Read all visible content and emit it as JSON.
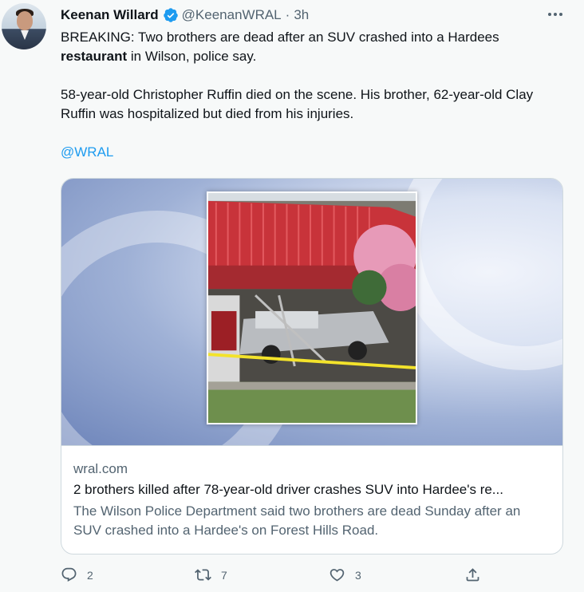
{
  "tweet": {
    "author_name": "Keenan Willard",
    "handle": "@KeenanWRAL",
    "separator": "·",
    "time": "3h",
    "text_line1_a": "BREAKING: Two brothers are dead after an SUV crashed into a Hardees",
    "text_line2_bold": "restaurant",
    "text_line2_rest": " in Wilson, police say.",
    "text_para2": "58-year-old Christopher Ruffin died on the scene. His brother, 62-year-old Clay Ruffin was hospitalized but died from his injuries.",
    "mention": "@WRAL"
  },
  "card": {
    "domain": "wral.com",
    "title": "2 brothers killed after 78-year-old driver crashes SUV into Hardee's re...",
    "description": "The Wilson Police Department said two brothers are dead Sunday after an SUV crashed into a Hardee's on Forest Hills Road."
  },
  "actions": {
    "replies": "2",
    "retweets": "7",
    "likes": "3"
  },
  "colors": {
    "accent": "#1d9bf0",
    "secondary_text": "#536471",
    "primary_text": "#0f1419",
    "border": "#cfd9de"
  },
  "icons": [
    "verified-badge-icon",
    "more-icon",
    "reply-icon",
    "retweet-icon",
    "like-icon",
    "share-icon"
  ]
}
